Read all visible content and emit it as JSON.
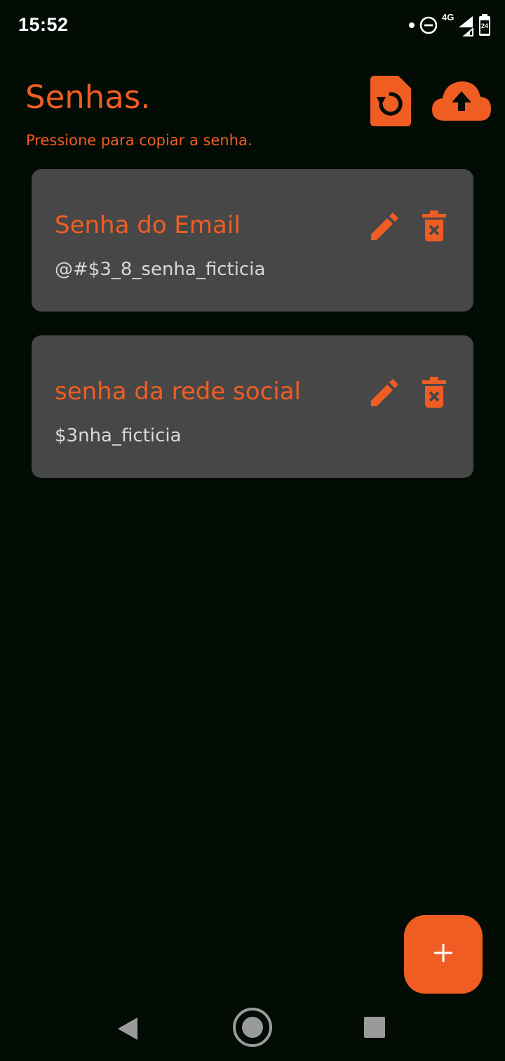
{
  "status_bar": {
    "time": "15:52",
    "network_label": "4G",
    "battery_level": "24",
    "icons": [
      "notification-dot-icon",
      "do-not-disturb-icon",
      "signal-4g-icon",
      "signal-icon",
      "battery-icon"
    ]
  },
  "header": {
    "title": "Senhas.",
    "subtitle": "Pressione para copiar a senha.",
    "actions": [
      {
        "icon": "restore-file-icon"
      },
      {
        "icon": "cloud-upload-icon"
      }
    ]
  },
  "passwords": [
    {
      "title": "Senha do Email",
      "password": "@#$3_8_senha_ficticia"
    },
    {
      "title": "senha da rede social",
      "password": "$3nha_ficticia"
    }
  ],
  "fab": {
    "label": "+",
    "icon": "add-icon"
  },
  "nav_bar": {
    "icons": [
      "back-icon",
      "home-icon",
      "recents-icon"
    ]
  },
  "colors": {
    "background": "#020c05",
    "accent": "#f05d23",
    "card": "#474747",
    "password_text": "#d8d8d8"
  }
}
